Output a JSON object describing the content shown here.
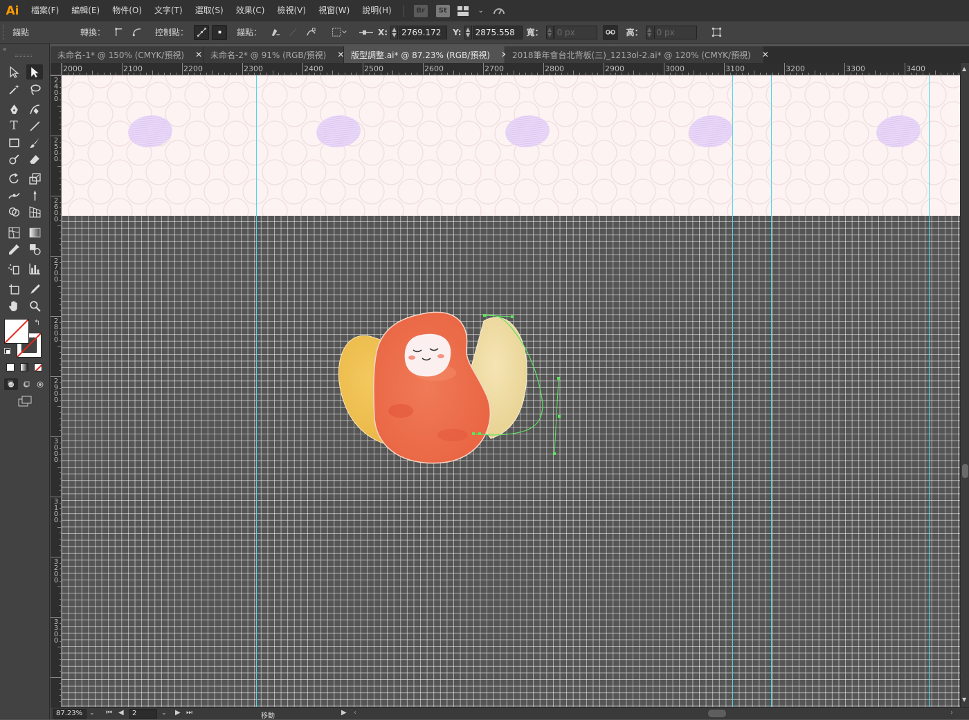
{
  "app": {
    "logo": "Ai"
  },
  "menu": {
    "items": [
      "檔案(F)",
      "編輯(E)",
      "物件(O)",
      "文字(T)",
      "選取(S)",
      "效果(C)",
      "檢視(V)",
      "視窗(W)",
      "說明(H)"
    ],
    "bridge_label": "Br",
    "stock_label": "St"
  },
  "control": {
    "tool_name": "錨點",
    "convert_label": "轉換：",
    "handles_label": "控制點：",
    "anchors_label": "錨點：",
    "x_label": "X:",
    "x_value": "2769.172",
    "y_label": "Y:",
    "y_value": "2875.558",
    "w_label": "寬：",
    "w_value": "0 px",
    "h_label": "高：",
    "h_value": "0 px"
  },
  "tabs": [
    {
      "label": "未命名-1* @ 150% (CMYK/預視)",
      "active": false
    },
    {
      "label": "未命名-2* @ 91% (RGB/預視)",
      "active": false
    },
    {
      "label": "版型調整.ai* @ 87.23% (RGB/預視)",
      "active": true
    },
    {
      "label": "2018筆年會台北背板(三)_1213ol-2.ai* @ 120% (CMYK/預視)",
      "active": false
    }
  ],
  "ruler": {
    "top_labels": [
      "2000",
      "2100",
      "2200",
      "2300",
      "2400",
      "2500",
      "2600",
      "2700",
      "2800",
      "2900",
      "3000",
      "3100",
      "3200",
      "3300",
      "3400"
    ],
    "left_labels": [
      "2400",
      "2500",
      "2600",
      "2700",
      "2800",
      "2900",
      "3000",
      "3100",
      "3200",
      "3300"
    ]
  },
  "status": {
    "zoom": "87.23%",
    "artboard": "2",
    "tool_hint": "移動"
  },
  "colors": {
    "accent": "#ff9a00",
    "guide": "#4fd6e6",
    "path_selection": "#5ee35e",
    "band": "#fdf3f3"
  }
}
